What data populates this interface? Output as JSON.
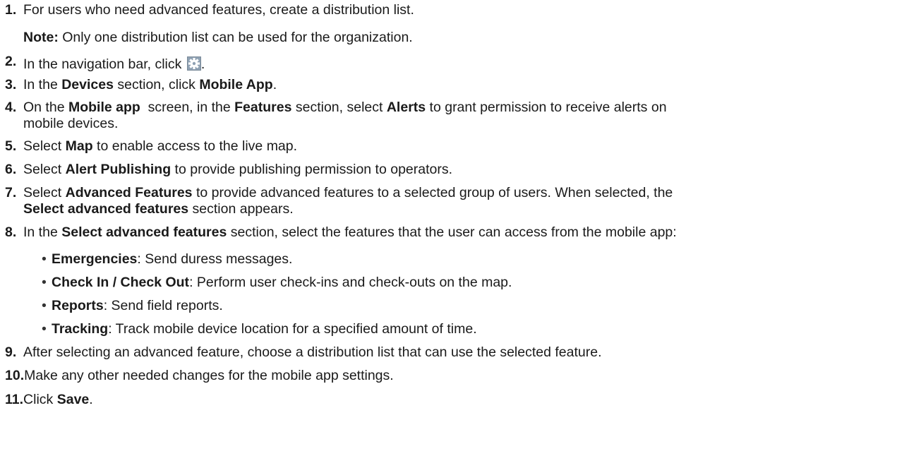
{
  "steps": [
    {
      "num": "1.",
      "parts": [
        "For users who need advanced features, create a distribution list."
      ]
    },
    {
      "note_label": "Note:",
      "note_text": " Only one distribution list can be used for the organization."
    },
    {
      "num": "2.",
      "parts": [
        "In the navigation bar, click ",
        "."
      ],
      "icon": "gear-icon"
    },
    {
      "num": "3.",
      "t1": "In the ",
      "b1": "Devices",
      "t2": " section, click ",
      "b2": "Mobile App",
      "t3": "."
    },
    {
      "num": "4.",
      "t1": "On the ",
      "b1": "Mobile app",
      "t2": "  screen, in the ",
      "b2": "Features",
      "t3": " section, select ",
      "b3": "Alerts",
      "t4": " to grant permission to receive alerts on",
      "cont": "mobile devices."
    },
    {
      "num": "5.",
      "t1": "Select ",
      "b1": "Map",
      "t2": " to enable access to the live map."
    },
    {
      "num": "6.",
      "t1": "Select ",
      "b1": "Alert Publishing",
      "t2": " to provide publishing permission to operators."
    },
    {
      "num": "7.",
      "t1": "Select ",
      "b1": "Advanced Features",
      "t2": " to provide advanced features to a selected group of users. When selected, the",
      "cont_b": "Select advanced features",
      "cont_t": " section appears."
    },
    {
      "num": "8.",
      "t1": "In the ",
      "b1": "Select advanced features",
      "t2": " section, select the features that the user can access from the mobile app:"
    },
    {
      "num": "9.",
      "parts": [
        "After selecting an advanced feature, choose a distribution list that can use the selected feature."
      ]
    },
    {
      "num": "10.",
      "parts": [
        "Make any other needed changes for the mobile app settings."
      ]
    },
    {
      "num": "11.",
      "t1": "Click ",
      "b1": "Save",
      "t2": "."
    }
  ],
  "bullets": [
    {
      "dot": "•",
      "b": "Emergencies",
      "t": ": Send duress messages."
    },
    {
      "dot": "•",
      "b": "Check In / Check Out",
      "t": ": Perform user check-ins and check-outs on the map."
    },
    {
      "dot": "•",
      "b": "Reports",
      "t": ": Send field reports."
    },
    {
      "dot": "•",
      "b": "Tracking",
      "t": ": Track mobile device location for a specified amount of time."
    }
  ]
}
